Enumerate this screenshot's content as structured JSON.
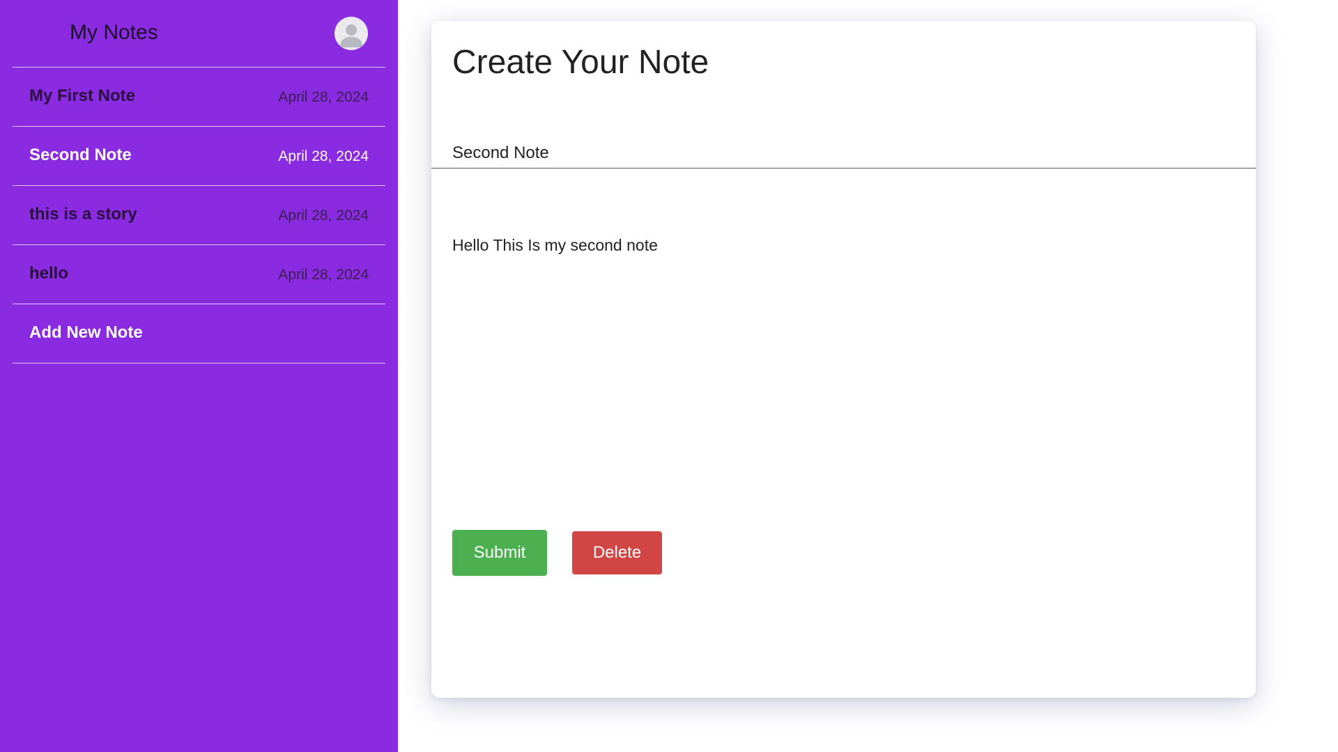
{
  "sidebar": {
    "title": "My Notes",
    "avatar_icon": "user-avatar-icon",
    "notes": [
      {
        "title": "My First Note",
        "date": "April 28, 2024",
        "active": false
      },
      {
        "title": "Second Note",
        "date": "April 28, 2024",
        "active": true
      },
      {
        "title": "this is a story",
        "date": "April 28, 2024",
        "active": false
      },
      {
        "title": "hello",
        "date": "April 28, 2024",
        "active": false
      }
    ],
    "add_label": "Add New Note"
  },
  "editor": {
    "heading": "Create Your Note",
    "title_value": "Second Note",
    "body_value": "Hello This Is my second note",
    "submit_label": "Submit",
    "delete_label": "Delete"
  },
  "colors": {
    "sidebar_bg": "#8a2be2",
    "submit": "#4caf50",
    "delete": "#d14545"
  }
}
